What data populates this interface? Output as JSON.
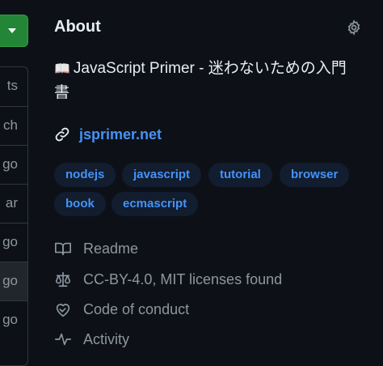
{
  "sidebar_fragments": [
    "ts",
    "ch",
    "go",
    "ar",
    "go",
    "go",
    "go"
  ],
  "about": {
    "title": "About",
    "description_emoji": "📖",
    "description": "JavaScript Primer - 迷わないための入門書",
    "website": "jsprimer.net",
    "topics": [
      "nodejs",
      "javascript",
      "tutorial",
      "browser",
      "book",
      "ecmascript"
    ],
    "meta": {
      "readme": "Readme",
      "license": "CC-BY-4.0, MIT licenses found",
      "code_of_conduct": "Code of conduct",
      "activity": "Activity"
    }
  },
  "colors": {
    "background": "#0d1117",
    "accent_link": "#4493f8",
    "topic_bg": "#121d2f",
    "muted": "#8d96a0",
    "primary_button": "#238636"
  }
}
